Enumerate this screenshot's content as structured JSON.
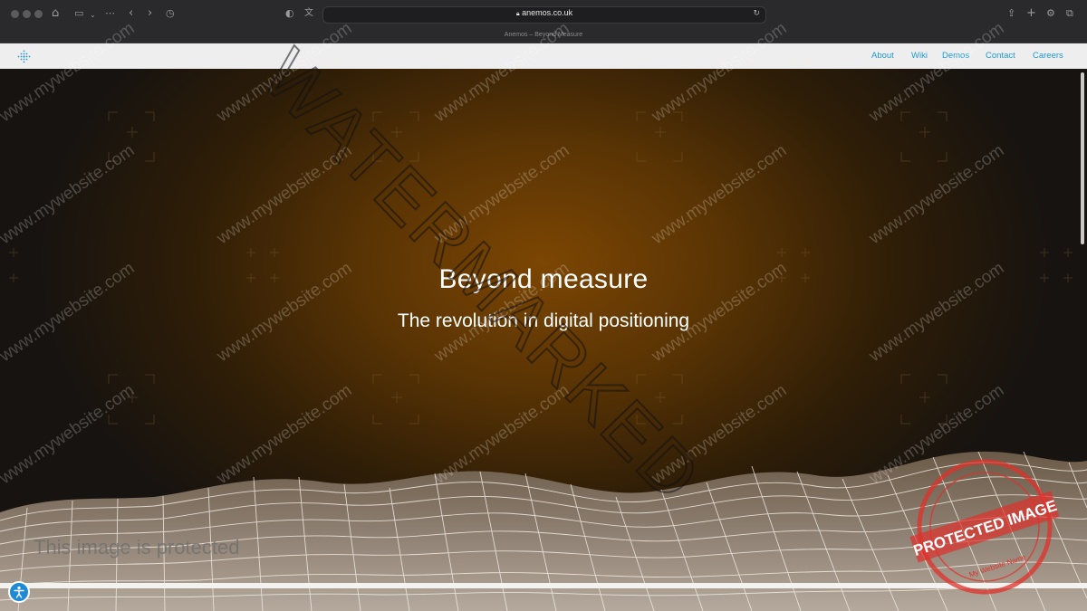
{
  "browser": {
    "url": "anemos.co.uk",
    "tab_title": "Anemos – Beyond Measure"
  },
  "site_nav": {
    "items": [
      {
        "label": "About"
      },
      {
        "label": "Wiki"
      },
      {
        "label": "Demos"
      },
      {
        "label": "Contact"
      },
      {
        "label": "Careers"
      }
    ],
    "link_color": "#1d9ad6"
  },
  "hero": {
    "title": "Beyond measure",
    "subtitle": "The revolution in digital positioning",
    "accent_color": "#7c4603"
  },
  "watermark": {
    "main": "WATERMARKED",
    "tile": "www.mywebsite.com",
    "protected_text": "This image is protected",
    "stamp_text": "PROTECTED IMAGE",
    "stamp_subtext": "My Website Name",
    "stamp_color": "#e0312b"
  },
  "icons": {
    "lock": "lock-icon",
    "reload": "reload-icon",
    "accessibility": "accessibility-icon"
  }
}
